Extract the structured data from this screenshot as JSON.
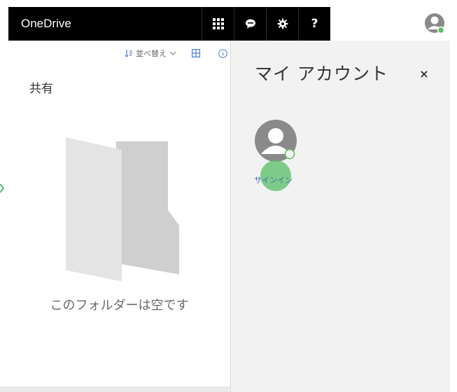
{
  "header": {
    "app_title": "OneDrive",
    "buttons": [
      {
        "name": "app-launcher",
        "icon": "waffle-icon"
      },
      {
        "name": "feedback",
        "icon": "chat-icon"
      },
      {
        "name": "settings",
        "icon": "gear-icon"
      },
      {
        "name": "help",
        "icon": "help-icon",
        "label": "?"
      }
    ]
  },
  "toolbar": {
    "sort_label": "並べ替え",
    "sort_icon": "sort-icon",
    "view_icon": "grid-view-icon",
    "info_icon": "info-icon"
  },
  "main": {
    "heading": "共有",
    "empty_message": "このフォルダーは空です"
  },
  "account_panel": {
    "title": "マイ アカウント",
    "close_label": "×",
    "signin_label": "サインイン"
  },
  "colors": {
    "topbar": "#000000",
    "panel_bg": "#f2f2f2",
    "link": "#3b6fb6",
    "status_green": "#5bbf5f"
  }
}
